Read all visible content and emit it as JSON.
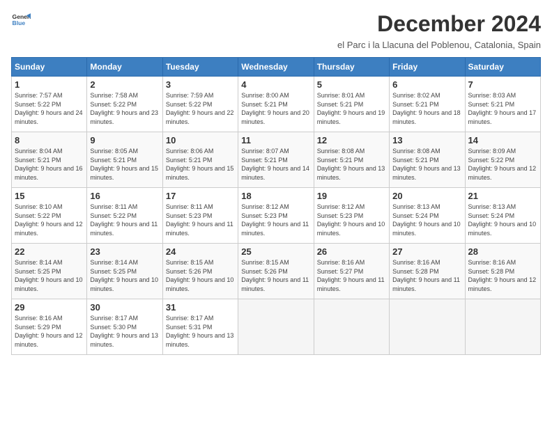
{
  "logo": {
    "line1": "General",
    "line2": "Blue"
  },
  "title": "December 2024",
  "subtitle": "el Parc i la Llacuna del Poblenou, Catalonia, Spain",
  "days_header": [
    "Sunday",
    "Monday",
    "Tuesday",
    "Wednesday",
    "Thursday",
    "Friday",
    "Saturday"
  ],
  "weeks": [
    [
      {
        "num": "1",
        "rise": "7:57 AM",
        "set": "5:22 PM",
        "daylight": "9 hours and 24 minutes."
      },
      {
        "num": "2",
        "rise": "7:58 AM",
        "set": "5:22 PM",
        "daylight": "9 hours and 23 minutes."
      },
      {
        "num": "3",
        "rise": "7:59 AM",
        "set": "5:22 PM",
        "daylight": "9 hours and 22 minutes."
      },
      {
        "num": "4",
        "rise": "8:00 AM",
        "set": "5:21 PM",
        "daylight": "9 hours and 20 minutes."
      },
      {
        "num": "5",
        "rise": "8:01 AM",
        "set": "5:21 PM",
        "daylight": "9 hours and 19 minutes."
      },
      {
        "num": "6",
        "rise": "8:02 AM",
        "set": "5:21 PM",
        "daylight": "9 hours and 18 minutes."
      },
      {
        "num": "7",
        "rise": "8:03 AM",
        "set": "5:21 PM",
        "daylight": "9 hours and 17 minutes."
      }
    ],
    [
      {
        "num": "8",
        "rise": "8:04 AM",
        "set": "5:21 PM",
        "daylight": "9 hours and 16 minutes."
      },
      {
        "num": "9",
        "rise": "8:05 AM",
        "set": "5:21 PM",
        "daylight": "9 hours and 15 minutes."
      },
      {
        "num": "10",
        "rise": "8:06 AM",
        "set": "5:21 PM",
        "daylight": "9 hours and 15 minutes."
      },
      {
        "num": "11",
        "rise": "8:07 AM",
        "set": "5:21 PM",
        "daylight": "9 hours and 14 minutes."
      },
      {
        "num": "12",
        "rise": "8:08 AM",
        "set": "5:21 PM",
        "daylight": "9 hours and 13 minutes."
      },
      {
        "num": "13",
        "rise": "8:08 AM",
        "set": "5:21 PM",
        "daylight": "9 hours and 13 minutes."
      },
      {
        "num": "14",
        "rise": "8:09 AM",
        "set": "5:22 PM",
        "daylight": "9 hours and 12 minutes."
      }
    ],
    [
      {
        "num": "15",
        "rise": "8:10 AM",
        "set": "5:22 PM",
        "daylight": "9 hours and 12 minutes."
      },
      {
        "num": "16",
        "rise": "8:11 AM",
        "set": "5:22 PM",
        "daylight": "9 hours and 11 minutes."
      },
      {
        "num": "17",
        "rise": "8:11 AM",
        "set": "5:23 PM",
        "daylight": "9 hours and 11 minutes."
      },
      {
        "num": "18",
        "rise": "8:12 AM",
        "set": "5:23 PM",
        "daylight": "9 hours and 11 minutes."
      },
      {
        "num": "19",
        "rise": "8:12 AM",
        "set": "5:23 PM",
        "daylight": "9 hours and 10 minutes."
      },
      {
        "num": "20",
        "rise": "8:13 AM",
        "set": "5:24 PM",
        "daylight": "9 hours and 10 minutes."
      },
      {
        "num": "21",
        "rise": "8:13 AM",
        "set": "5:24 PM",
        "daylight": "9 hours and 10 minutes."
      }
    ],
    [
      {
        "num": "22",
        "rise": "8:14 AM",
        "set": "5:25 PM",
        "daylight": "9 hours and 10 minutes."
      },
      {
        "num": "23",
        "rise": "8:14 AM",
        "set": "5:25 PM",
        "daylight": "9 hours and 10 minutes."
      },
      {
        "num": "24",
        "rise": "8:15 AM",
        "set": "5:26 PM",
        "daylight": "9 hours and 10 minutes."
      },
      {
        "num": "25",
        "rise": "8:15 AM",
        "set": "5:26 PM",
        "daylight": "9 hours and 11 minutes."
      },
      {
        "num": "26",
        "rise": "8:16 AM",
        "set": "5:27 PM",
        "daylight": "9 hours and 11 minutes."
      },
      {
        "num": "27",
        "rise": "8:16 AM",
        "set": "5:28 PM",
        "daylight": "9 hours and 11 minutes."
      },
      {
        "num": "28",
        "rise": "8:16 AM",
        "set": "5:28 PM",
        "daylight": "9 hours and 12 minutes."
      }
    ],
    [
      {
        "num": "29",
        "rise": "8:16 AM",
        "set": "5:29 PM",
        "daylight": "9 hours and 12 minutes."
      },
      {
        "num": "30",
        "rise": "8:17 AM",
        "set": "5:30 PM",
        "daylight": "9 hours and 13 minutes."
      },
      {
        "num": "31",
        "rise": "8:17 AM",
        "set": "5:31 PM",
        "daylight": "9 hours and 13 minutes."
      },
      null,
      null,
      null,
      null
    ]
  ]
}
